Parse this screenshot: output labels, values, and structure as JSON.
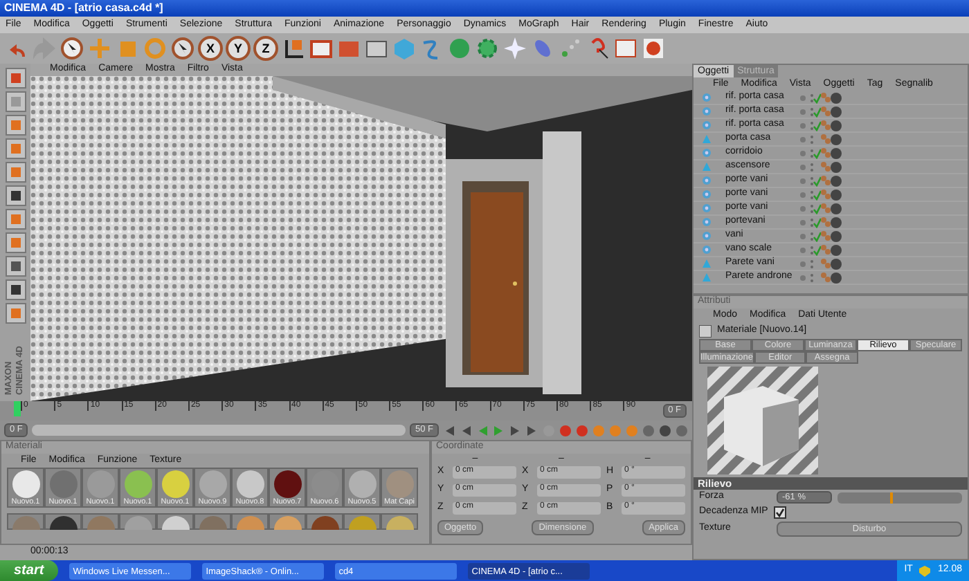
{
  "window": {
    "title": "CINEMA 4D - [atrio casa.c4d *]"
  },
  "menu": [
    "File",
    "Modifica",
    "Oggetti",
    "Strumenti",
    "Selezione",
    "Struttura",
    "Funzioni",
    "Animazione",
    "Personaggio",
    "Dynamics",
    "MoGraph",
    "Hair",
    "Rendering",
    "Plugin",
    "Finestre",
    "Aiuto"
  ],
  "toolbar": {
    "axis_buttons": [
      "X",
      "Y",
      "Z"
    ]
  },
  "viewport": {
    "menu": [
      "Modifica",
      "Camere",
      "Mostra",
      "Filtro",
      "Vista"
    ]
  },
  "object_manager": {
    "tabs": [
      {
        "label": "Oggetti",
        "selected": true
      },
      {
        "label": "Struttura",
        "selected": false
      }
    ],
    "menu": [
      "File",
      "Modifica",
      "Vista",
      "Oggetti",
      "Tag",
      "Segnalib"
    ],
    "objects": [
      {
        "name": "rif. porta casa",
        "kind": "instance",
        "checked": true
      },
      {
        "name": "rif. porta casa",
        "kind": "instance",
        "checked": true
      },
      {
        "name": "rif. porta casa",
        "kind": "instance",
        "checked": true
      },
      {
        "name": "porta casa",
        "kind": "polygon",
        "checked": false
      },
      {
        "name": "corridoio",
        "kind": "instance",
        "checked": true
      },
      {
        "name": "ascensore",
        "kind": "polygon",
        "checked": false
      },
      {
        "name": "porte vani",
        "kind": "instance",
        "checked": true
      },
      {
        "name": "porte vani",
        "kind": "instance",
        "checked": true
      },
      {
        "name": "porte vani",
        "kind": "instance",
        "checked": true
      },
      {
        "name": "portevani",
        "kind": "instance",
        "checked": true
      },
      {
        "name": "vani",
        "kind": "instance",
        "checked": true
      },
      {
        "name": "vano scale",
        "kind": "instance",
        "checked": true
      },
      {
        "name": "Parete vani",
        "kind": "polygon",
        "checked": false
      },
      {
        "name": "Parete androne",
        "kind": "polygon",
        "checked": false
      }
    ]
  },
  "attributes": {
    "title": "Attributi",
    "menu": [
      "Modo",
      "Modifica",
      "Dati Utente"
    ],
    "material": "Materiale [Nuovo.14]",
    "tab_rows": [
      {
        "tabs": [
          {
            "label": "Base",
            "selected": false
          },
          {
            "label": "Colore",
            "selected": false
          },
          {
            "label": "Luminanza",
            "selected": false
          },
          {
            "label": "Rilievo",
            "selected": true
          },
          {
            "label": "Speculare",
            "selected": false
          }
        ]
      },
      {
        "tabs": [
          {
            "label": "Illuminazione",
            "selected": false
          },
          {
            "label": "Editor",
            "selected": false
          },
          {
            "label": "Assegna",
            "selected": false
          }
        ]
      }
    ],
    "section": "Rilievo",
    "forza": {
      "label": "Forza",
      "value": "-61 %",
      "level": 0.42
    },
    "decadenza": {
      "label": "Decadenza MIP",
      "checked": true
    },
    "texture": {
      "label": "Texture",
      "shader": "Disturbo"
    }
  },
  "timeline": {
    "ticks": [
      "0",
      "5",
      "10",
      "15",
      "20",
      "25",
      "30",
      "35",
      "40",
      "45",
      "50",
      "55",
      "60",
      "65",
      "70",
      "75",
      "80",
      "85",
      "90"
    ],
    "current": "0 F",
    "start": "0 F",
    "end": "50 F"
  },
  "materials": {
    "title": "Materiali",
    "menu": [
      "File",
      "Modifica",
      "Funzione",
      "Texture"
    ],
    "items": [
      {
        "name": "Nuovo.1",
        "color": "#e8e8e8"
      },
      {
        "name": "Nuovo.1",
        "color": "#707070"
      },
      {
        "name": "Nuovo.1",
        "color": "#9a9a9a"
      },
      {
        "name": "Nuovo.1",
        "color": "#8ac050"
      },
      {
        "name": "Nuovo.1",
        "color": "#d8d040"
      },
      {
        "name": "Nuovo.9",
        "color": "#a8a8a8"
      },
      {
        "name": "Nuovo.8",
        "color": "#c8c8c8"
      },
      {
        "name": "Nuovo.7",
        "color": "#601010"
      },
      {
        "name": "Nuovo.6",
        "color": "#8c8c8c"
      },
      {
        "name": "Nuovo.5",
        "color": "#b0b0b0"
      },
      {
        "name": "Mat Capi",
        "color": "#a09080"
      }
    ],
    "second_row": [
      {
        "color": "#8a7a6a"
      },
      {
        "color": "#303030"
      },
      {
        "color": "#907860"
      },
      {
        "color": "#a0a0a0"
      },
      {
        "color": "#d0d0d0"
      },
      {
        "color": "#807060"
      },
      {
        "color": "#d09050"
      },
      {
        "color": "#d8a060"
      },
      {
        "color": "#804020"
      },
      {
        "color": "#c0a020"
      },
      {
        "color": "#c8b060"
      }
    ]
  },
  "coordinates": {
    "title": "Coordinate",
    "headers": [
      "–",
      "–",
      "–"
    ],
    "rows": [
      {
        "labels": [
          "X",
          "X",
          "H"
        ],
        "values": [
          "0 cm",
          "0 cm",
          "0 °"
        ]
      },
      {
        "labels": [
          "Y",
          "Y",
          "P"
        ],
        "values": [
          "0 cm",
          "0 cm",
          "0 °"
        ]
      },
      {
        "labels": [
          "Z",
          "Z",
          "B"
        ],
        "values": [
          "0 cm",
          "0 cm",
          "0 °"
        ]
      }
    ],
    "buttons": [
      "Oggetto",
      "Dimensione",
      "Applica"
    ]
  },
  "side_logo": [
    "MAXON",
    "CINEMA 4D"
  ],
  "status_bar": {
    "time": "00:00:13"
  },
  "taskbar": {
    "start": "start",
    "tasks": [
      {
        "label": "Windows Live Messen...",
        "selected": false
      },
      {
        "label": "ImageShack® - Onlin...",
        "selected": false
      },
      {
        "label": "cd4",
        "selected": false
      },
      {
        "label": "CINEMA 4D - [atrio c...",
        "selected": true
      }
    ],
    "language": "IT",
    "clock": "12.08"
  }
}
